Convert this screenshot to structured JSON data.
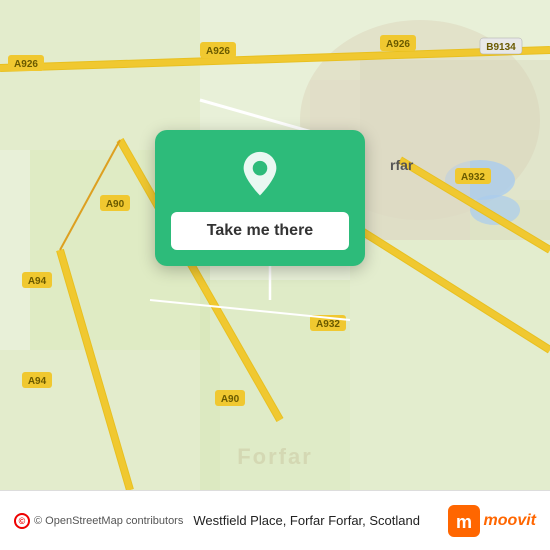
{
  "map": {
    "background_color": "#e8f0d8",
    "watermark": "Forfar"
  },
  "popup": {
    "button_label": "Take me there",
    "background_color": "#2dbb7a"
  },
  "bottom_bar": {
    "osm_credit": "© OpenStreetMap contributors",
    "location_text": "Westfield Place, Forfar Forfar, Scotland",
    "moovit_label": "moovit"
  },
  "road_labels": [
    "A926",
    "A926",
    "A926",
    "B9134",
    "A932",
    "A932",
    "A90",
    "A90",
    "A94",
    "A94"
  ]
}
